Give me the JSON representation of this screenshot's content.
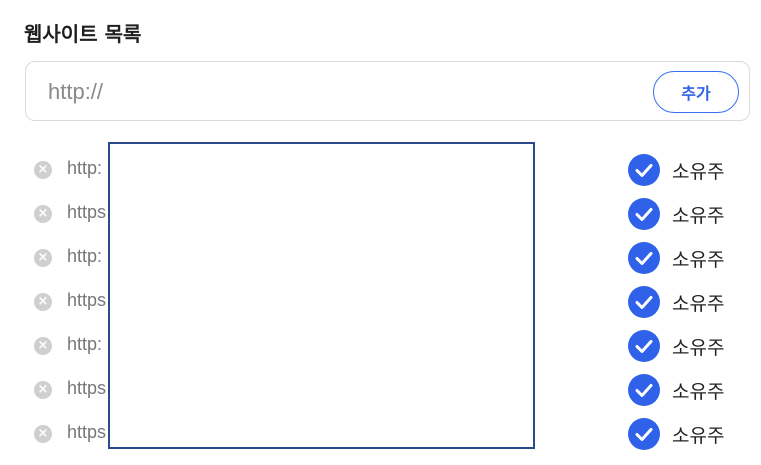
{
  "section_title": "웹사이트 목록",
  "url_input": {
    "placeholder": "http://",
    "value": ""
  },
  "add_button_label": "추가",
  "sites": [
    {
      "url": "http:",
      "status": "소유주"
    },
    {
      "url": "https",
      "status": "소유주"
    },
    {
      "url": "http:",
      "status": "소유주"
    },
    {
      "url": "https",
      "status": "소유주"
    },
    {
      "url": "http:",
      "status": "소유주"
    },
    {
      "url": "https",
      "status": "소유주"
    },
    {
      "url": "https",
      "status": "소유주"
    }
  ],
  "icons": {
    "remove": "remove-icon",
    "verified": "check-circle-icon"
  },
  "colors": {
    "accent": "#2f62e8",
    "remove_icon": "#cfcfcf"
  }
}
